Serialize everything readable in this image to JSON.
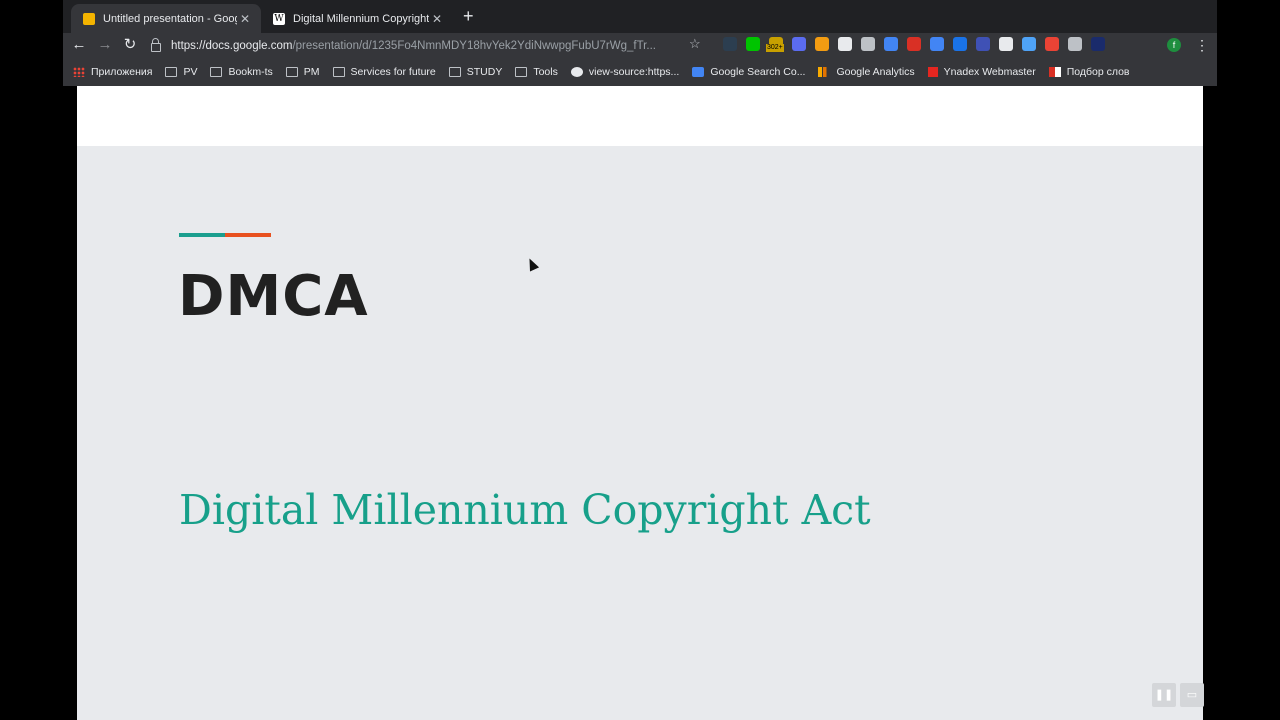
{
  "tabs": [
    {
      "title": "Untitled presentation - Google Slides",
      "favicon": "slides-icon",
      "color": "#f4b400"
    },
    {
      "title": "Digital Millennium Copyright Act - Wikipedia",
      "favicon": "wikipedia-icon",
      "color": "#ffffff"
    }
  ],
  "tab_favicon_letters": {
    "wikipedia": "W"
  },
  "url": {
    "host": "https://docs.google.com",
    "path": "/presentation/d/1235Fo4NmnMDY18hvYek2YdiNwwpgFubU7rWg_fTr..."
  },
  "profile_initial": "f",
  "bookmarks": [
    {
      "label": "Приложения",
      "icon": "apps"
    },
    {
      "label": "PV",
      "icon": "folder"
    },
    {
      "label": "Bookm-ts",
      "icon": "folder"
    },
    {
      "label": "PM",
      "icon": "folder"
    },
    {
      "label": "Services for future",
      "icon": "folder"
    },
    {
      "label": "STUDY",
      "icon": "folder"
    },
    {
      "label": "Tools",
      "icon": "folder"
    },
    {
      "label": "view-source:https...",
      "icon": "globe"
    },
    {
      "label": "Google Search Co...",
      "icon": "search-console"
    },
    {
      "label": "Google Analytics",
      "icon": "analytics"
    },
    {
      "label": "Ynadex Webmaster",
      "icon": "yandex"
    },
    {
      "label": "Подбор слов",
      "icon": "wordstat"
    }
  ],
  "extensions": [
    {
      "name": "ext-1-icon",
      "color": "#2c3e50"
    },
    {
      "name": "ext-2-icon",
      "color": "#00c400"
    },
    {
      "name": "ext-3-icon",
      "color": "#c8a000",
      "badge": "302+"
    },
    {
      "name": "ext-4-icon",
      "color": "#5b6cf0"
    },
    {
      "name": "ext-5-icon",
      "color": "#f39c12"
    },
    {
      "name": "ext-6-icon",
      "color": "#e8eaed"
    },
    {
      "name": "ext-7-icon",
      "color": "#bdc1c6"
    },
    {
      "name": "ext-8-icon",
      "color": "#4285f4"
    },
    {
      "name": "ext-9-icon",
      "color": "#d93025"
    },
    {
      "name": "ext-10-icon",
      "color": "#4285f4"
    },
    {
      "name": "ext-11-icon",
      "color": "#1a73e8"
    },
    {
      "name": "ext-12-icon",
      "color": "#3f51b5"
    },
    {
      "name": "ext-13-icon",
      "color": "#e8eaed"
    },
    {
      "name": "ext-14-icon",
      "color": "#4fa3f7"
    },
    {
      "name": "ext-15-icon",
      "color": "#ea4335"
    },
    {
      "name": "ext-16-icon",
      "color": "#bdc1c6"
    },
    {
      "name": "ext-17-icon",
      "color": "#1a2b6b"
    }
  ],
  "slide": {
    "title": "DMCA",
    "subtitle": "Digital Millennium Copyright Act",
    "accent_colors": [
      "#1b9e8e",
      "#e8511f"
    ],
    "title_color": "#212121",
    "subtitle_color": "#17a08a"
  }
}
